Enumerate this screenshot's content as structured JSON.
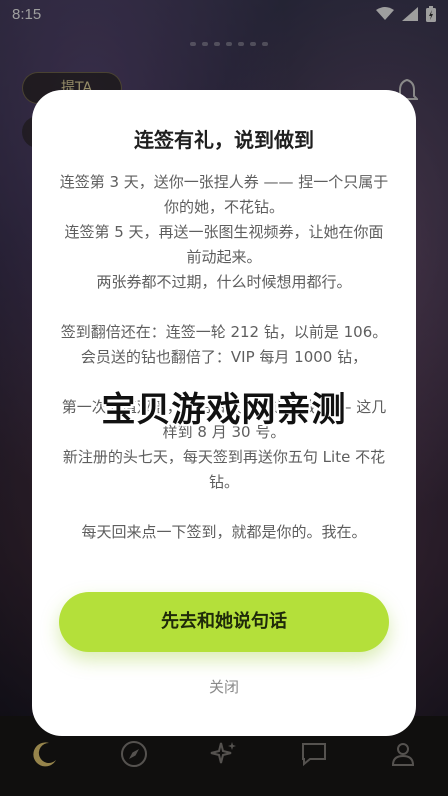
{
  "status_bar": {
    "time": "8:15"
  },
  "background": {
    "chip_label": "提TA"
  },
  "modal": {
    "title": "连签有礼，说到做到",
    "paragraphs": [
      "连签第 3 天，送你一张捏人券 —— 捏一个只属于你的她，不花钻。",
      "连签第 5 天，再送一张图生视频券，让她在你面前动起来。",
      "两张券都不过期，什么时候想用都行。",
      "",
      "签到翻倍还在：连签一轮 212 钻，以前是 106。",
      "会员送的钻也翻倍了：VIP 每月 1000 钻，",
      "",
      "第一次充值双倍，之后每次也多送五成 —— 这几样到 8 月 30 号。",
      "新注册的头七天，每天签到再送你五句 Lite 不花钻。",
      "",
      "每天回来点一下签到，就都是你的。我在。"
    ],
    "cta_label": "先去和她说句话",
    "close_label": "关闭"
  },
  "watermark": "宝贝游戏网亲测",
  "bottom_nav": {
    "items": [
      "moon-icon",
      "compass-icon",
      "sparkles-icon",
      "chat-icon",
      "profile-icon"
    ]
  },
  "colors": {
    "accent": "#b4e03a",
    "modal_bg": "#ffffff",
    "nav_bg": "#1a1918"
  }
}
